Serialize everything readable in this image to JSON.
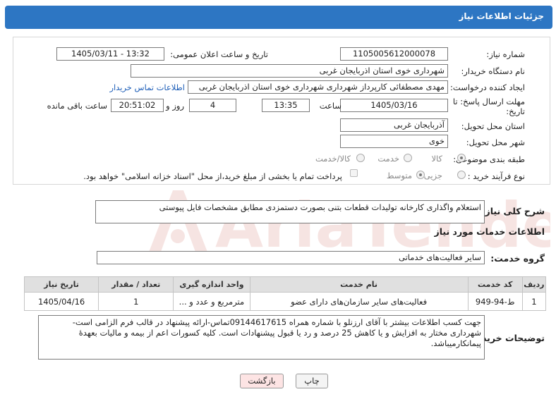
{
  "header": {
    "title": "جزئیات اطلاعات نیاز"
  },
  "form": {
    "need_number_label": "شماره نیاز:",
    "need_number": "1105005612000078",
    "announce_label": "تاریخ و ساعت اعلان عمومی:",
    "announce_value": "1405/03/11 - 13:32",
    "buyer_label": "نام دستگاه خریدار:",
    "buyer_value": "شهرداری خوی استان اذربایجان غربی",
    "creator_label": "ایجاد کننده درخواست:",
    "creator_value": "مهدی مصطفائی کارپرداز شهرداری شهرداری خوی استان اذربایجان غربی",
    "contact_link": "اطلاعات تماس خریدار",
    "deadline_label_1": "مهلت ارسال پاسخ: تا",
    "deadline_label_2": "تاریخ:",
    "deadline_date": "1405/03/16",
    "time_label": "ساعت",
    "deadline_time": "13:35",
    "days_value": "4",
    "days_label": "روز و",
    "remaining_time": "20:51:02",
    "remaining_label": "ساعت باقی مانده",
    "province_label": "استان محل تحویل:",
    "province_value": "آذربایجان غربی",
    "city_label": "شهر محل تحویل:",
    "city_value": "خوی",
    "category_label": "طبقه بندی موضوعی:",
    "category_options": [
      "کالا",
      "خدمت",
      "کالا/خدمت"
    ],
    "process_label": "نوع فرآیند خرید :",
    "process_options": [
      "جزیی",
      "متوسط"
    ],
    "payment_note": "پرداخت تمام یا بخشی از مبلغ خرید،از محل \"اسناد خزانه اسلامی\" خواهد بود."
  },
  "description": {
    "label": "شرح کلی نیاز:",
    "value": "استعلام واگذاری کارخانه تولیدات قطعات بتنی بصورت دستمزدی مطابق مشخصات فایل پیوستی"
  },
  "services": {
    "section_title": "اطلاعات خدمات مورد نیاز",
    "group_label": "گروه خدمت:",
    "group_value": "سایر فعالیت‌های خدماتی",
    "columns": [
      "ردیف",
      "کد خدمت",
      "نام خدمت",
      "واحد اندازه گیری",
      "تعداد / مقدار",
      "تاریخ نیاز"
    ],
    "rows": [
      {
        "row": "1",
        "code": "ط-94-949",
        "name": "فعالیت‌های سایر سازمان‌های دارای عضو",
        "unit": "مترمربع و عدد و ...",
        "qty": "1",
        "date": "1405/04/16"
      }
    ]
  },
  "buyer_notes": {
    "label": "توضیحات خریدار:",
    "value": "جهت کسب اطلاعات بیشتر با آقای ارزنلو با شماره همراه 09144617615تماس-ارائه پیشنهاد در قالب فرم الزامی است-شهرداری مختار به افزایش و یا کاهش 25 درصد و رد یا قبول پیشنهادات است. کلیه کسورات اعم از بیمه و مالیات بعهدهٔ پیمانکارمیباشد."
  },
  "buttons": {
    "print": "چاپ",
    "back": "بازگشت"
  },
  "watermark": {
    "text": "AriaTender.neT"
  },
  "colors": {
    "header": "#2d76c3",
    "back_button": "#fde4e4",
    "watermark": "#c0392b"
  }
}
